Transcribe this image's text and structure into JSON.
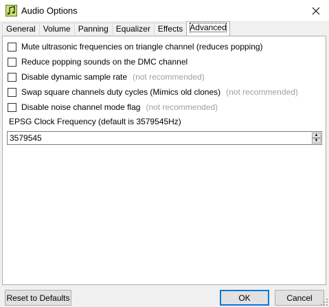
{
  "window": {
    "title": "Audio Options"
  },
  "tabs": [
    {
      "label": "General"
    },
    {
      "label": "Volume"
    },
    {
      "label": "Panning"
    },
    {
      "label": "Equalizer"
    },
    {
      "label": "Effects"
    },
    {
      "label": "Advanced",
      "active": true
    }
  ],
  "options": [
    {
      "label": "Mute ultrasonic frequencies on triangle channel (reduces popping)",
      "note": "",
      "checked": false
    },
    {
      "label": "Reduce popping sounds on the DMC channel",
      "note": "",
      "checked": false
    },
    {
      "label": "Disable dynamic sample rate",
      "note": "(not recommended)",
      "checked": false
    },
    {
      "label": "Swap square channels duty cycles (Mimics old clones)",
      "note": "(not recommended)",
      "checked": false
    },
    {
      "label": "Disable noise channel mode flag",
      "note": "(not recommended)",
      "checked": false
    }
  ],
  "epsg": {
    "label": "EPSG Clock Frequency (default is 3579545Hz)",
    "value": "3579545",
    "up_glyph": "▲",
    "down_glyph": "▼"
  },
  "buttons": {
    "reset": "Reset to Defaults",
    "ok": "OK",
    "cancel": "Cancel"
  },
  "icons": {
    "app": "music-note-icon",
    "close": "close-icon",
    "grip": "resize-grip-icon"
  }
}
